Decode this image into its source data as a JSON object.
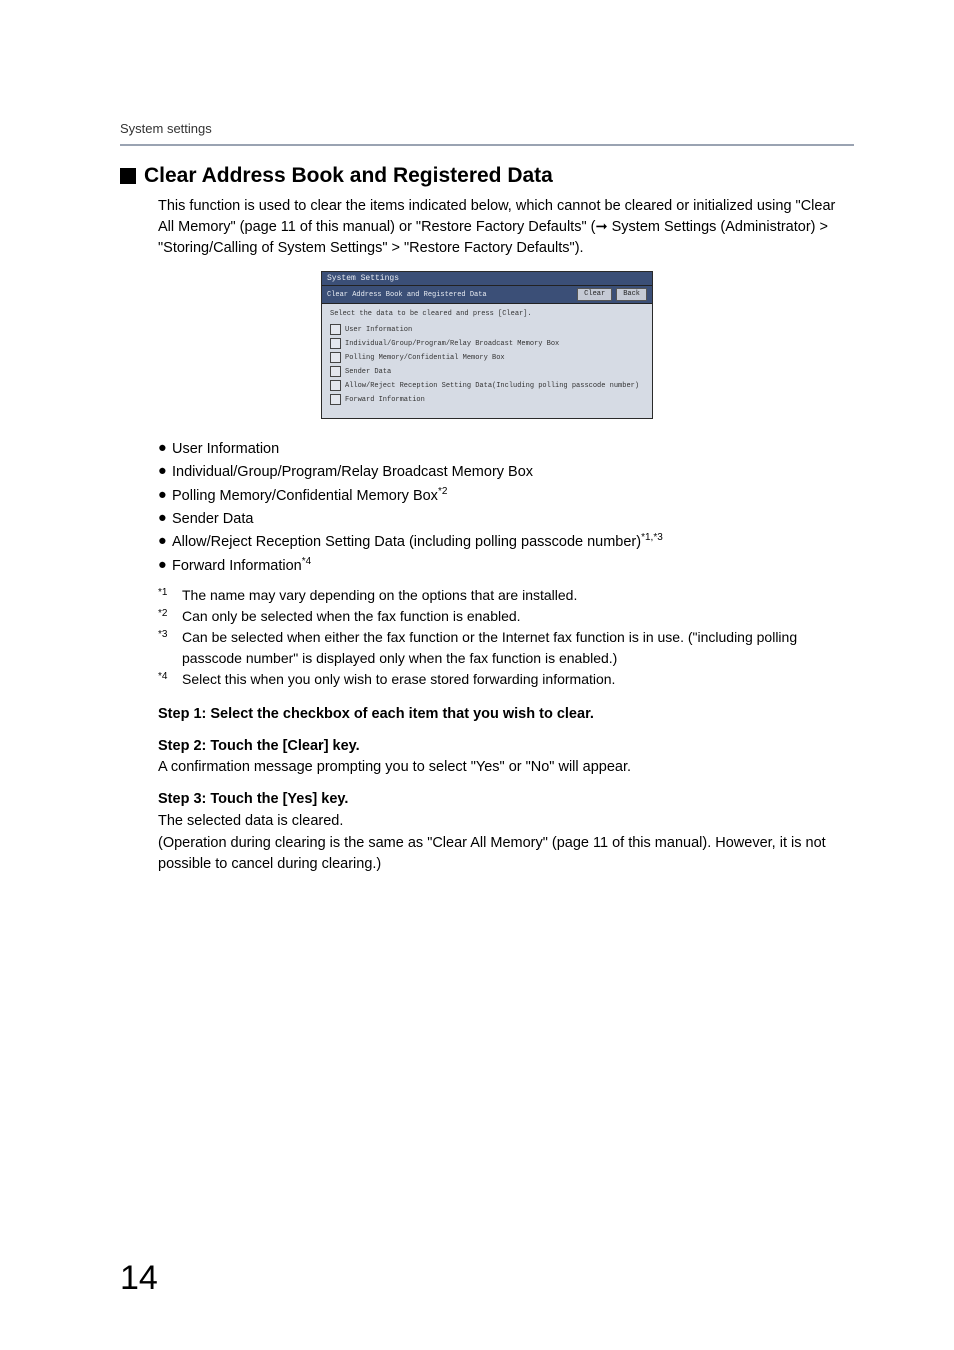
{
  "header": {
    "label": "System settings"
  },
  "section": {
    "title": "Clear Address Book and Registered Data",
    "intro": "This function is used to clear the items indicated below, which cannot be cleared or initialized using \"Clear All Memory\" (page 11 of this manual) or \"Restore Factory Defaults\" (➞ System Settings (Administrator) > \"Storing/Calling of System Settings\" > \"Restore Factory Defaults\")."
  },
  "screenshot": {
    "title": "System Settings",
    "subtitle": "Clear Address Book and Registered Data",
    "btn_clear": "Clear",
    "btn_back": "Back",
    "instruction": "Select the data to be cleared and press [Clear].",
    "items": [
      "User Information",
      "Individual/Group/Program/Relay Broadcast Memory Box",
      "Polling Memory/Confidential Memory Box",
      "Sender Data",
      "Allow/Reject Reception Setting Data(Including polling passcode number)",
      "Forward Information"
    ]
  },
  "bullets": [
    {
      "text": "User Information",
      "sup": ""
    },
    {
      "text": "Individual/Group/Program/Relay Broadcast Memory Box",
      "sup": ""
    },
    {
      "text": "Polling Memory/Confidential Memory Box",
      "sup": "*2"
    },
    {
      "text": "Sender Data",
      "sup": ""
    },
    {
      "text": "Allow/Reject Reception Setting Data (including polling passcode number)",
      "sup": "*1,*3"
    },
    {
      "text": "Forward Information",
      "sup": "*4"
    }
  ],
  "footnotes": [
    {
      "mark": "*1",
      "text": "The name may vary depending on the options that are installed."
    },
    {
      "mark": "*2",
      "text": "Can only be selected when the fax function is enabled."
    },
    {
      "mark": "*3",
      "text": "Can be selected when either the fax function or the Internet fax function is in use. (\"including polling passcode number\" is displayed only when the fax function is enabled.)"
    },
    {
      "mark": "*4",
      "text": "Select this when you only wish to erase stored forwarding information."
    }
  ],
  "steps": {
    "s1_h": "Step 1: Select the checkbox of each item that you wish to clear.",
    "s2_h": "Step 2: Touch the [Clear] key.",
    "s2_t": "A confirmation message prompting you to select \"Yes\" or \"No\" will appear.",
    "s3_h": "Step 3: Touch the [Yes] key.",
    "s3_t1": "The selected data is cleared.",
    "s3_t2": "(Operation during clearing is the same as \"Clear All Memory\" (page 11 of this manual). However, it is not possible to cancel during clearing.)"
  },
  "page_number": "14"
}
